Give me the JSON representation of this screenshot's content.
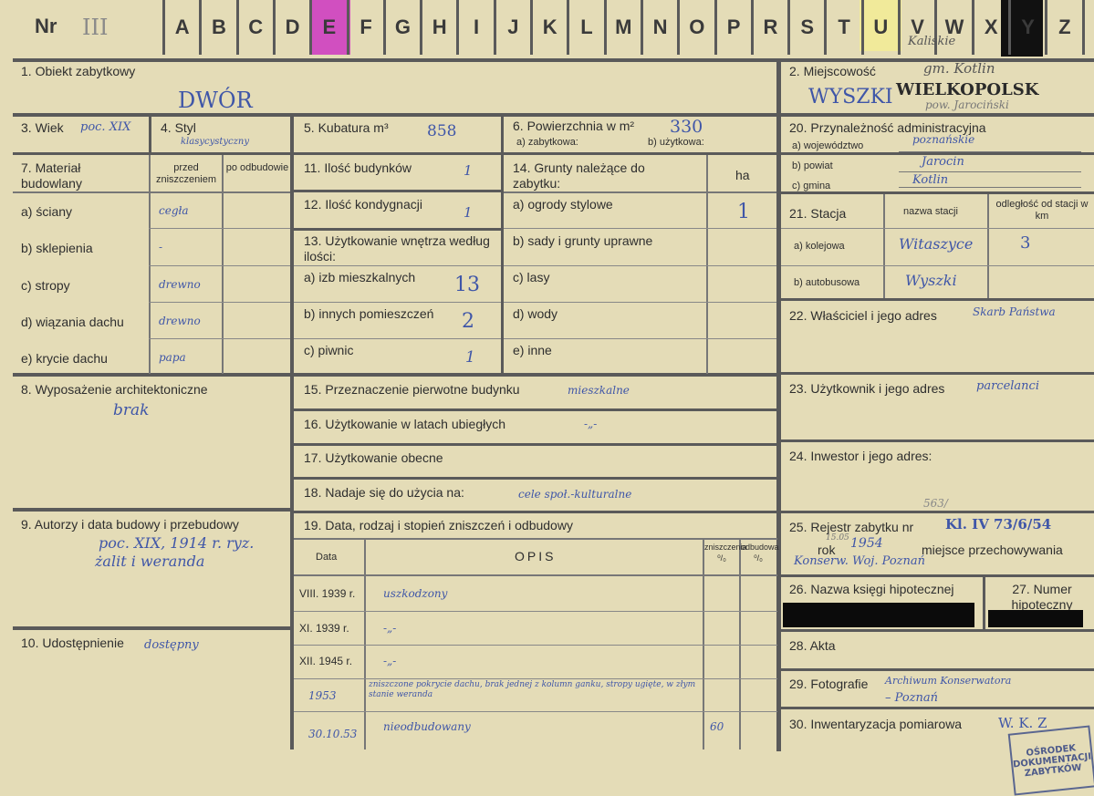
{
  "header": {
    "nr_label": "Nr",
    "nr_value": "III",
    "letters": [
      "A",
      "B",
      "C",
      "D",
      "E",
      "F",
      "G",
      "H",
      "I",
      "J",
      "K",
      "L",
      "M",
      "N",
      "O",
      "P",
      "R",
      "S",
      "T",
      "U",
      "V",
      "W",
      "X",
      "Y",
      "Z"
    ],
    "tab_colors": {
      "E": "#d14fc0",
      "U": "#f1ea9a",
      "Y": "#111111"
    },
    "note_above": "Kaliskie"
  },
  "f1": {
    "label": "1. Obiekt zabytkowy",
    "value": "DWÓR"
  },
  "f2": {
    "label": "2. Miejscowość",
    "value": "WYSZKI",
    "stamp": "WIELKOPOLSK",
    "note_gm": "gm. Kotlin",
    "note_pow": "pow. Jarociński"
  },
  "f3": {
    "label": "3. Wiek",
    "value": "poc. XIX"
  },
  "f4": {
    "label": "4. Styl",
    "value": "klasycystyczny"
  },
  "f5": {
    "label": "5. Kubatura m³",
    "value": "858"
  },
  "f6": {
    "label": "6. Powierzchnia w m²",
    "value": "330",
    "sub_a": "a) zabytkowa:",
    "sub_b": "b) użytkowa:"
  },
  "f7": {
    "label": "7. Materiał budowlany",
    "col_before": "przed zniszczeniem",
    "col_after": "po odbudowie",
    "rows": [
      {
        "label": "a) ściany",
        "value": "cegła"
      },
      {
        "label": "b) sklepienia",
        "value": "-"
      },
      {
        "label": "c) stropy",
        "value": "drewno"
      },
      {
        "label": "d) wiązania dachu",
        "value": "drewno"
      },
      {
        "label": "e) krycie dachu",
        "value": "papa"
      }
    ]
  },
  "f11": {
    "label": "11. Ilość budynków",
    "value": "1"
  },
  "f12": {
    "label": "12. Ilość kondygnacji",
    "value": "1"
  },
  "f13": {
    "label": "13. Użytkowanie wnętrza według ilości:",
    "a": {
      "label": "a) izb mieszkalnych",
      "value": "13"
    },
    "b": {
      "label": "b) innych pomieszczeń",
      "value": "2"
    },
    "c": {
      "label": "c) piwnic",
      "value": "1"
    }
  },
  "f14": {
    "label": "14. Grunty należące do zabytku:",
    "unit": "ha",
    "rows": [
      {
        "label": "a) ogrody stylowe",
        "value": "1"
      },
      {
        "label": "b) sady i grunty uprawne",
        "value": ""
      },
      {
        "label": "c) lasy",
        "value": ""
      },
      {
        "label": "d) wody",
        "value": ""
      },
      {
        "label": "e) inne",
        "value": ""
      }
    ]
  },
  "f20": {
    "label": "20. Przynależność administracyjna",
    "a_label": "a) województwo",
    "a_value": "poznańskie",
    "b_label": "b) powiat",
    "b_value": "Jarocin",
    "c_label": "c) gmina",
    "c_value": "Kotlin"
  },
  "f21": {
    "label": "21. Stacja",
    "col_name": "nazwa stacji",
    "col_dist": "odległość od stacji w km",
    "rail_label": "a) kolejowa",
    "rail_name": "Witaszyce",
    "rail_dist": "3",
    "bus_label": "b) autobusowa",
    "bus_name": "Wyszki"
  },
  "f22": {
    "label": "22. Właściciel i jego adres",
    "value": "Skarb Państwa"
  },
  "f8": {
    "label": "8. Wyposażenie architektoniczne",
    "value": "brak"
  },
  "f15": {
    "label": "15. Przeznaczenie pierwotne budynku",
    "value": "mieszkalne"
  },
  "f16": {
    "label": "16. Użytkowanie w latach ubiegłych",
    "value": "-„-"
  },
  "f17": {
    "label": "17. Użytkowanie obecne"
  },
  "f18": {
    "label": "18. Nadaje się do użycia na:",
    "value": "cele społ.-kulturalne"
  },
  "f23": {
    "label": "23. Użytkownik i jego adres",
    "value": "parcelanci"
  },
  "f24": {
    "label": "24. Inwestor i jego adres:"
  },
  "f9": {
    "label": "9. Autorzy i data budowy i przebudowy",
    "line1": "poc. XIX, 1914 r. ryz.",
    "line2": "żalit i weranda"
  },
  "f10": {
    "label": "10. Udostępnienie",
    "value": "dostępny"
  },
  "f19": {
    "label": "19. Data, rodzaj i stopień zniszczeń i odbudowy",
    "col_date": "Data",
    "col_desc": "OPIS",
    "col_dmg": "zniszczenia ⁰/₀",
    "col_reb": "odbudowa ⁰/₀",
    "rows": [
      {
        "date": "VIII. 1939 r.",
        "desc": "uszkodzony",
        "dmg": ""
      },
      {
        "date": "XI. 1939 r.",
        "desc": "-„-",
        "dmg": ""
      },
      {
        "date": "XII. 1945 r.",
        "desc": "-„-",
        "dmg": ""
      },
      {
        "date": "1953",
        "desc": "zniszczone pokrycie dachu, brak jednej z kolumn ganku, stropy ugięte, w złym stanie weranda",
        "dmg": ""
      },
      {
        "date": "30.10.53",
        "desc": "nieodbudowany",
        "dmg": "60"
      }
    ]
  },
  "f25": {
    "label": "25. Rejestr zabytku nr",
    "value": "Kl. IV 73/6/54",
    "note_number": "563/",
    "rok_label": "rok",
    "rok_value": "1954",
    "rok_date": "15.05",
    "place_label": "miejsce przechowywania",
    "place_value": "Konserw. Woj. Poznań"
  },
  "f26": {
    "label": "26. Nazwa księgi hipotecznej"
  },
  "f27": {
    "label": "27. Numer hipoteczny"
  },
  "f28": {
    "label": "28. Akta"
  },
  "f29": {
    "label": "29. Fotografie",
    "value": "Archiwum Konserwatora",
    "value2": "– Poznań"
  },
  "f30": {
    "label": "30. Inwentaryzacja pomiarowa",
    "value": "W. K. Z"
  },
  "stamp": {
    "lines": [
      "OŚRODEK",
      "DOKUMENTACJI",
      "ZABYTKÓW"
    ]
  }
}
